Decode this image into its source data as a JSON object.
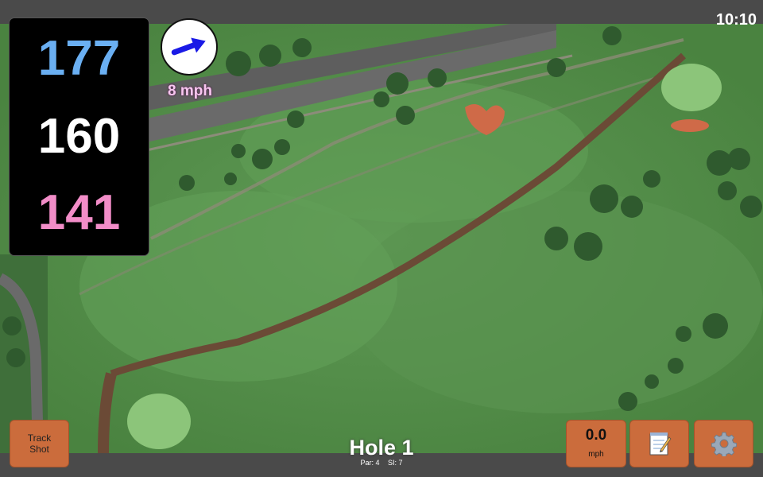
{
  "status_bar": {
    "time": "10:10"
  },
  "distances": {
    "back": "177",
    "middle": "160",
    "front": "141"
  },
  "wind": {
    "speed": "8 mph",
    "direction_icon": "arrow-right-icon"
  },
  "hole": {
    "title": "Hole 1",
    "par": "Par: 4",
    "stroke_index": "SI: 7"
  },
  "buttons": {
    "track_shot_line1": "Track",
    "track_shot_line2": "Shot",
    "speed_value": "0.0",
    "speed_unit": "mph",
    "notes_icon": "notepad-icon",
    "settings_icon": "gear-icon"
  },
  "colors": {
    "back_distance": "#6aaff2",
    "middle_distance": "#ffffff",
    "front_distance": "#f28dc8",
    "button_orange": "#cb6c3c",
    "wind_arrow": "#1a1ae6"
  }
}
